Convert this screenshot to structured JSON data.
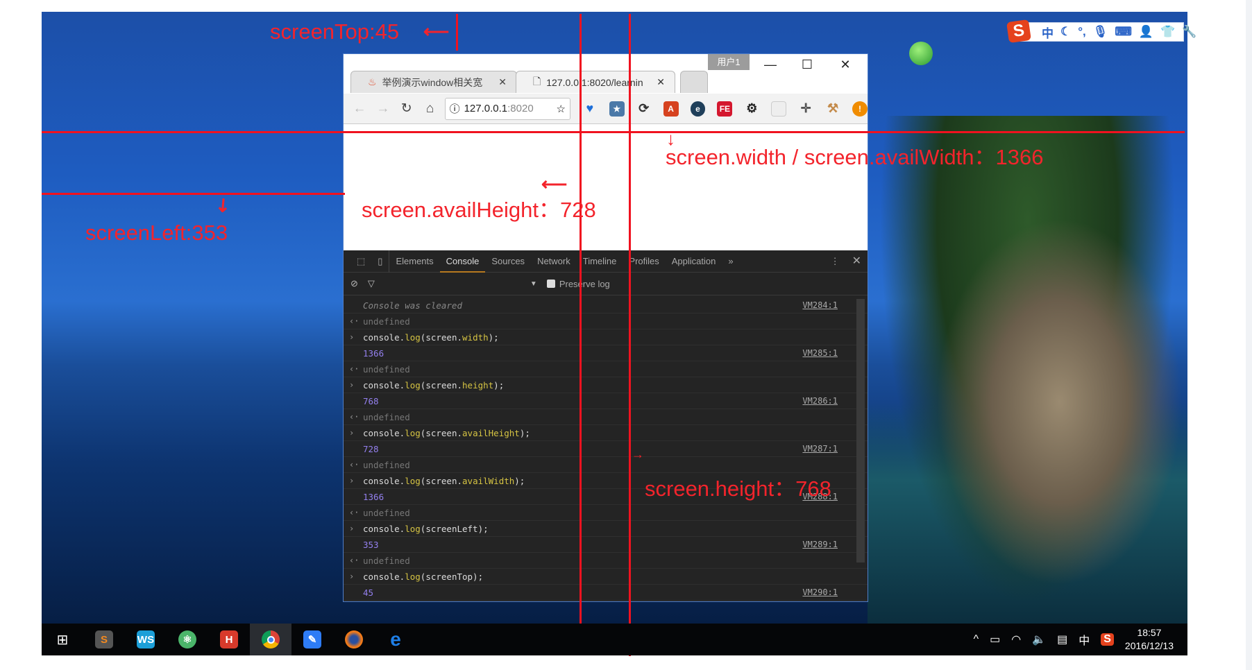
{
  "colors": {
    "annotation": "#f0121f",
    "devtools_bg": "#242424",
    "console_number": "#9480ef",
    "console_keyword": "#d6c443",
    "tab_active_underline": "#b7791f"
  },
  "ime_bar": {
    "logo": "S",
    "items": [
      "中",
      "☾",
      "°,",
      "mic-icon",
      "keyboard-icon",
      "user-icon",
      "shirt-icon",
      "wrench-icon"
    ]
  },
  "browser": {
    "user_badge": "用户1",
    "tabs": [
      {
        "title": "举例演示window相关宽",
        "icon": "flame-icon"
      },
      {
        "title": "127.0.0.1:8020/learnin",
        "icon": "page-icon",
        "active": true
      }
    ],
    "address": {
      "host": "127.0.0.1",
      "port": ":8020"
    },
    "devtools": {
      "tabs": [
        "Elements",
        "Console",
        "Sources",
        "Network",
        "Timeline",
        "Profiles",
        "Application"
      ],
      "more": "»",
      "active_tab": "Console",
      "preserve_log": "Preserve log",
      "rows": [
        {
          "type": "info",
          "text": "Console was cleared",
          "src": "VM284:1"
        },
        {
          "type": "result",
          "text": "undefined"
        },
        {
          "type": "input",
          "tokens": [
            [
              "console.",
              "w"
            ],
            [
              "log",
              "y"
            ],
            [
              "(screen.",
              "w"
            ],
            [
              "width",
              "y"
            ],
            [
              ");",
              "w"
            ]
          ]
        },
        {
          "type": "output",
          "text": "1366",
          "src": "VM285:1"
        },
        {
          "type": "result",
          "text": "undefined"
        },
        {
          "type": "input",
          "tokens": [
            [
              "console.",
              "w"
            ],
            [
              "log",
              "y"
            ],
            [
              "(screen.",
              "w"
            ],
            [
              "height",
              "y"
            ],
            [
              ");",
              "w"
            ]
          ]
        },
        {
          "type": "output",
          "text": "768",
          "src": "VM286:1"
        },
        {
          "type": "result",
          "text": "undefined"
        },
        {
          "type": "input",
          "tokens": [
            [
              "console.",
              "w"
            ],
            [
              "log",
              "y"
            ],
            [
              "(screen.",
              "w"
            ],
            [
              "availHeight",
              "y"
            ],
            [
              ");",
              "w"
            ]
          ]
        },
        {
          "type": "output",
          "text": "728",
          "src": "VM287:1"
        },
        {
          "type": "result",
          "text": "undefined"
        },
        {
          "type": "input",
          "tokens": [
            [
              "console.",
              "w"
            ],
            [
              "log",
              "y"
            ],
            [
              "(screen.",
              "w"
            ],
            [
              "availWidth",
              "y"
            ],
            [
              ");",
              "w"
            ]
          ]
        },
        {
          "type": "output",
          "text": "1366",
          "src": "VM288:1"
        },
        {
          "type": "result",
          "text": "undefined"
        },
        {
          "type": "input",
          "tokens": [
            [
              "console.",
              "w"
            ],
            [
              "log",
              "y"
            ],
            [
              "(screenLeft);",
              "w"
            ]
          ]
        },
        {
          "type": "output",
          "text": "353",
          "src": "VM289:1"
        },
        {
          "type": "result",
          "text": "undefined"
        },
        {
          "type": "input",
          "tokens": [
            [
              "console.",
              "w"
            ],
            [
              "log",
              "y"
            ],
            [
              "(screenTop);",
              "w"
            ]
          ]
        },
        {
          "type": "output",
          "text": "45",
          "src": "VM290:1"
        }
      ]
    }
  },
  "annotations": {
    "screen_top": "screenTop:45",
    "screen_width": "screen.width / screen.availWidth：1366",
    "avail_height": "screen.availHeight：728",
    "screen_left": "screenLeft:353",
    "screen_height": "screen.height：768"
  },
  "taskbar": {
    "apps": [
      "windows-start",
      "sublime-text",
      "webstorm",
      "atom",
      "hbuilder",
      "chrome",
      "feishu-notes",
      "firefox",
      "edge"
    ],
    "tray": {
      "ime": "中",
      "clock_time": "18:57",
      "clock_date": "2016/12/13"
    }
  }
}
